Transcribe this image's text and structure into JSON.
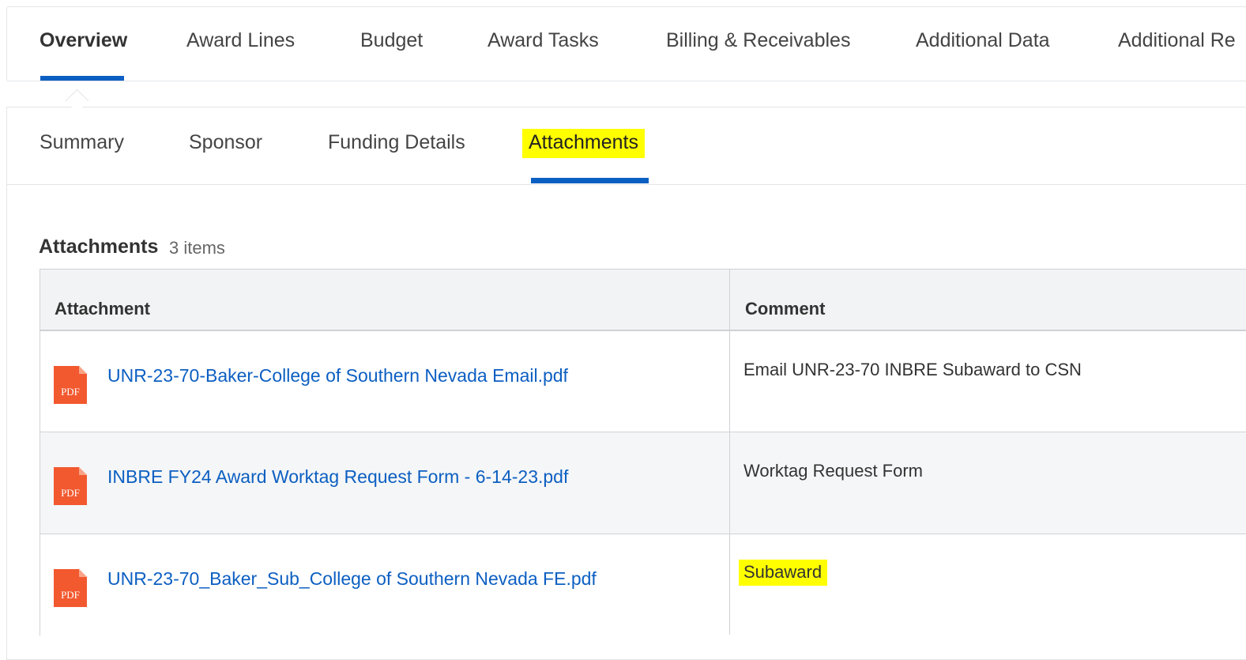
{
  "top_tabs": [
    {
      "label": "Overview",
      "active": true
    },
    {
      "label": "Award Lines"
    },
    {
      "label": "Budget"
    },
    {
      "label": "Award Tasks"
    },
    {
      "label": "Billing & Receivables"
    },
    {
      "label": "Additional Data"
    },
    {
      "label": "Additional Re"
    }
  ],
  "sub_tabs": [
    {
      "label": "Summary"
    },
    {
      "label": "Sponsor"
    },
    {
      "label": "Funding Details"
    },
    {
      "label": "Attachments",
      "active": true,
      "highlighted": true
    }
  ],
  "section": {
    "title": "Attachments",
    "count": "3 items"
  },
  "table": {
    "headers": [
      "Attachment",
      "Comment"
    ],
    "rows": [
      {
        "icon": "pdf-icon",
        "icon_text": "PDF",
        "file": "UNR-23-70-Baker-College of Southern Nevada Email.pdf",
        "comment": "Email UNR-23-70 INBRE Subaward to CSN"
      },
      {
        "icon": "pdf-icon",
        "icon_text": "PDF",
        "file": "INBRE FY24 Award Worktag Request Form - 6-14-23.pdf",
        "comment": "Worktag Request Form"
      },
      {
        "icon": "pdf-icon",
        "icon_text": "PDF",
        "file": "UNR-23-70_Baker_Sub_College of Southern Nevada FE.pdf",
        "comment": "Subaward",
        "comment_highlighted": true
      }
    ]
  },
  "colors": {
    "accent": "#0c5fc2",
    "highlight": "#ffff00",
    "pdf": "#f2592f"
  }
}
